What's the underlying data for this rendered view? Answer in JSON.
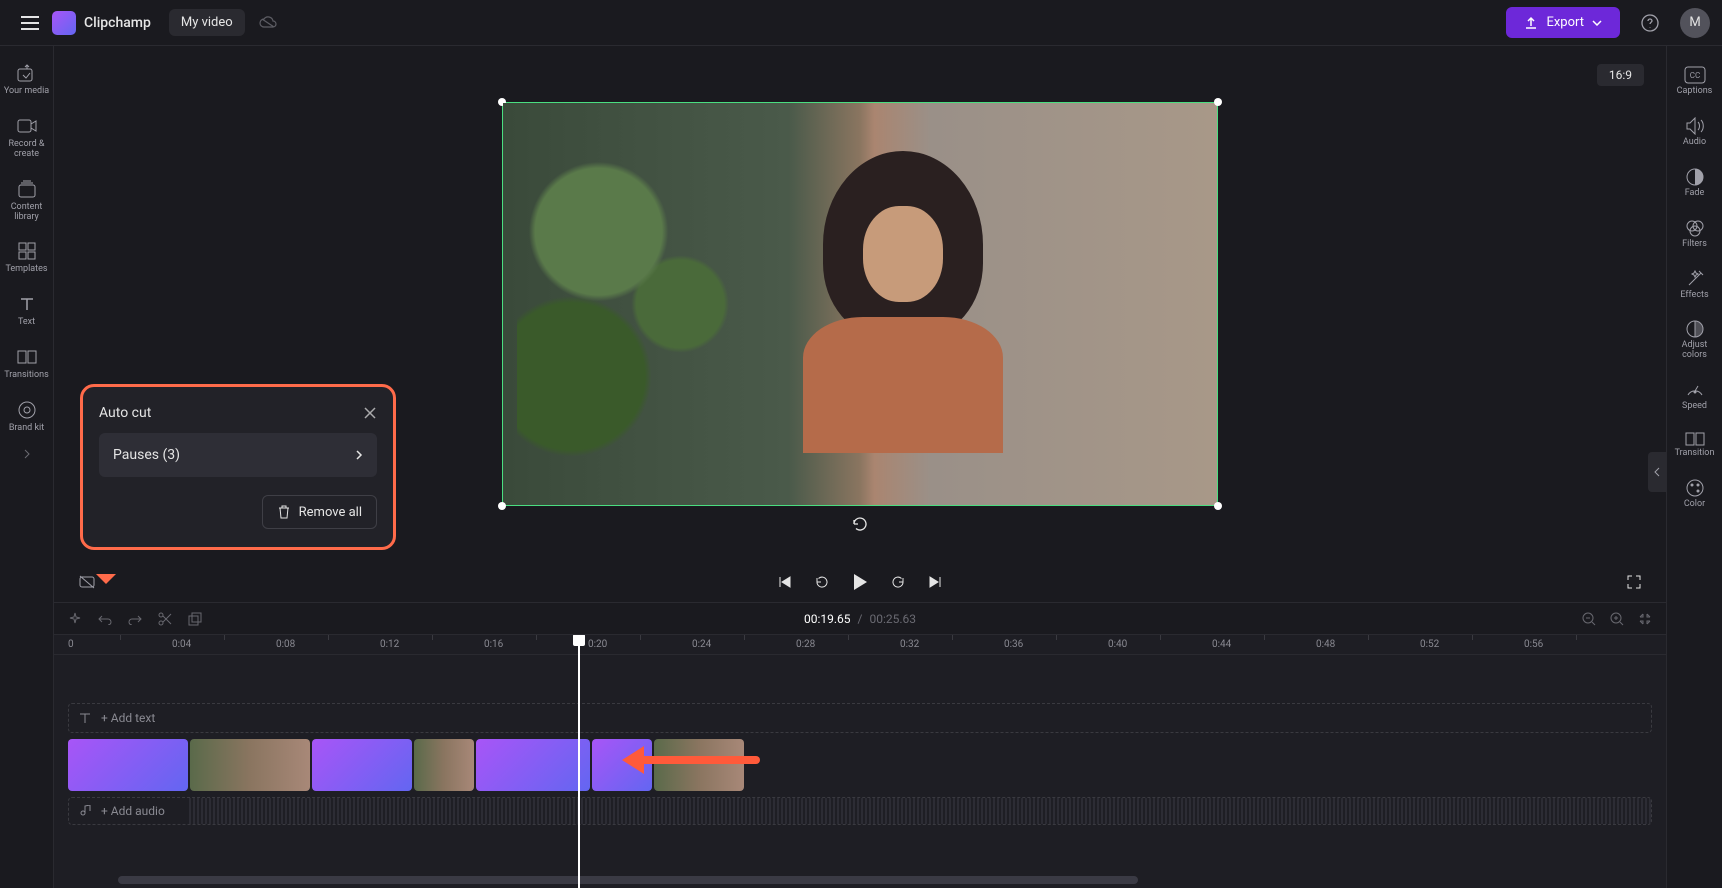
{
  "app": {
    "name": "Clipchamp",
    "video_title": "My video",
    "avatar_initial": "M"
  },
  "topbar": {
    "export_label": "Export",
    "ratio_badge": "16:9"
  },
  "left_rail": [
    {
      "id": "your-media",
      "label": "Your media"
    },
    {
      "id": "record-create",
      "label": "Record & create"
    },
    {
      "id": "content-library",
      "label": "Content library"
    },
    {
      "id": "templates",
      "label": "Templates"
    },
    {
      "id": "text",
      "label": "Text"
    },
    {
      "id": "transitions",
      "label": "Transitions"
    },
    {
      "id": "brand-kit",
      "label": "Brand kit"
    }
  ],
  "right_rail": [
    {
      "id": "captions",
      "label": "Captions"
    },
    {
      "id": "audio",
      "label": "Audio"
    },
    {
      "id": "fade",
      "label": "Fade"
    },
    {
      "id": "filters",
      "label": "Filters"
    },
    {
      "id": "effects",
      "label": "Effects"
    },
    {
      "id": "adjust-colors",
      "label": "Adjust colors"
    },
    {
      "id": "speed",
      "label": "Speed"
    },
    {
      "id": "transition",
      "label": "Transition"
    },
    {
      "id": "color",
      "label": "Color"
    }
  ],
  "autocut": {
    "title": "Auto cut",
    "pauses_label": "Pauses (3)",
    "remove_all_label": "Remove all"
  },
  "player": {
    "current_time": "00:19.65",
    "separator": "/",
    "total_time": "00:25.63"
  },
  "ruler": [
    "0",
    "0:04",
    "0:08",
    "0:12",
    "0:16",
    "0:20",
    "0:24",
    "0:28",
    "0:32",
    "0:36",
    "0:40",
    "0:44",
    "0:48",
    "0:52",
    "0:56"
  ],
  "tracks": {
    "text_placeholder": "+ Add text",
    "audio_placeholder": "+ Add audio"
  },
  "colors": {
    "accent": "#6d28d9",
    "highlight": "#ff6b4a",
    "selection": "#4ade80"
  }
}
